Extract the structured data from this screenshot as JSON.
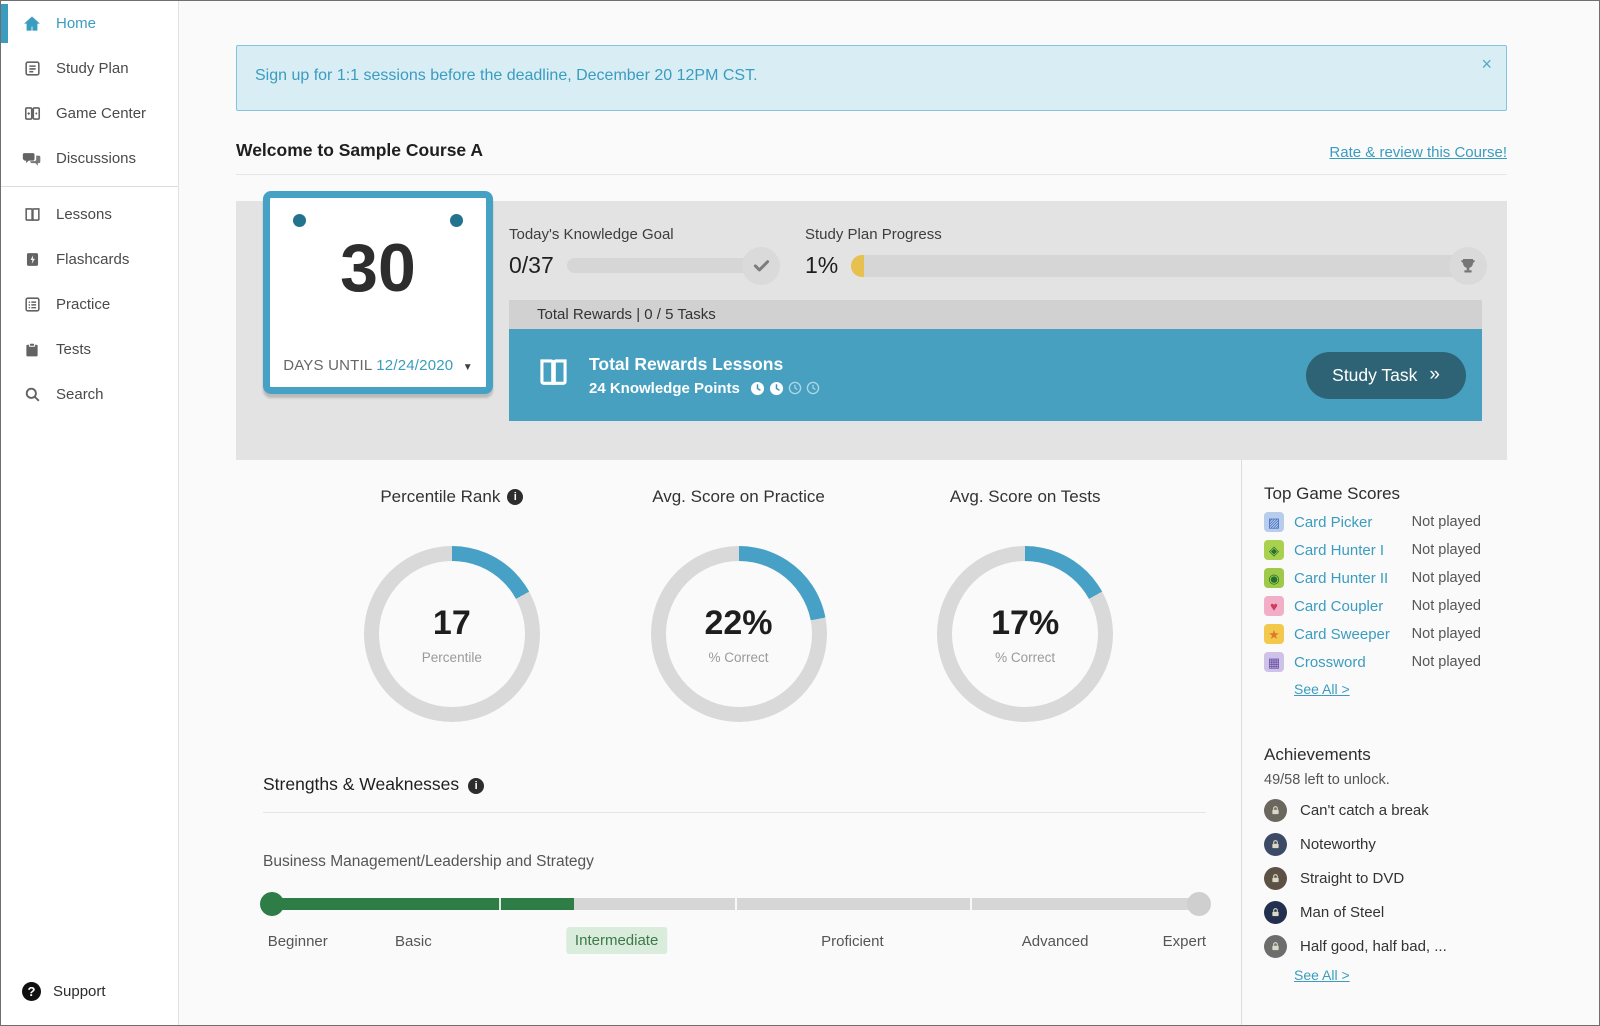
{
  "colors": {
    "accent_blue": "#3a9cbf",
    "card_blue": "#48a0c1",
    "button_teal": "#2d6374",
    "progress_gold": "#e6c14f",
    "skill_green": "#2e7d46"
  },
  "icons": {
    "close": "×",
    "caret_down": "▼",
    "chevron_right": "»"
  },
  "sidebar": {
    "items": [
      {
        "label": "Home",
        "active": true
      },
      {
        "label": "Study Plan"
      },
      {
        "label": "Game Center"
      },
      {
        "label": "Discussions"
      },
      {
        "label": "Lessons"
      },
      {
        "label": "Flashcards"
      },
      {
        "label": "Practice"
      },
      {
        "label": "Tests"
      },
      {
        "label": "Search"
      }
    ],
    "support_label": "Support"
  },
  "banner": {
    "message": "Sign up for 1:1 sessions before the deadline, December 20 12PM CST."
  },
  "header": {
    "title": "Welcome to Sample Course A",
    "rate_link": "Rate & review this Course!"
  },
  "hero": {
    "calendar": {
      "days": "30",
      "days_until_label": "DAYS UNTIL",
      "date": "12/24/2020"
    },
    "knowledge_goal": {
      "label": "Today's Knowledge Goal",
      "value": "0/37",
      "pct": 0
    },
    "study_plan_progress": {
      "label": "Study Plan Progress",
      "value": "1%",
      "pct": 1
    },
    "rewards_header": "Total Rewards | 0 / 5 Tasks",
    "task_card": {
      "title": "Total Rewards Lessons",
      "subtitle": "24 Knowledge Points",
      "button": "Study Task"
    }
  },
  "stats": {
    "donuts": [
      {
        "title": "Percentile Rank",
        "has_info": true,
        "value": "17",
        "caption": "Percentile",
        "pct": 17
      },
      {
        "title": "Avg. Score on Practice",
        "has_info": false,
        "value": "22%",
        "caption": "% Correct",
        "pct": 22
      },
      {
        "title": "Avg. Score on Tests",
        "has_info": false,
        "value": "17%",
        "caption": "% Correct",
        "pct": 17
      }
    ]
  },
  "strengths": {
    "title": "Strengths & Weaknesses",
    "subject": "Business Management/Leadership and Strategy",
    "progress_pct": 33,
    "levels": [
      "Beginner",
      "Basic",
      "Intermediate",
      "Proficient",
      "Advanced",
      "Expert"
    ],
    "active_index": 2
  },
  "games": {
    "title": "Top Game Scores",
    "see_all": "See All >",
    "items": [
      {
        "name": "Card Picker",
        "status": "Not played",
        "glyph": "▨",
        "bg": "#b8cdec",
        "fg": "#3f6fc0"
      },
      {
        "name": "Card Hunter I",
        "status": "Not played",
        "glyph": "◈",
        "bg": "#a9d14f",
        "fg": "#247031"
      },
      {
        "name": "Card Hunter II",
        "status": "Not played",
        "glyph": "◉",
        "bg": "#9fca49",
        "fg": "#247031"
      },
      {
        "name": "Card Coupler",
        "status": "Not played",
        "glyph": "♥",
        "bg": "#f3aec7",
        "fg": "#d23a5e"
      },
      {
        "name": "Card Sweeper",
        "status": "Not played",
        "glyph": "★",
        "bg": "#f2c94c",
        "fg": "#dd7a2a"
      },
      {
        "name": "Crossword",
        "status": "Not played",
        "glyph": "▦",
        "bg": "#cec2e8",
        "fg": "#6a4fa3"
      }
    ]
  },
  "achievements": {
    "title": "Achievements",
    "subtitle": "49/58 left to unlock.",
    "see_all": "See All >",
    "items": [
      {
        "name": "Can't catch a break",
        "badge_bg": "#6b675f"
      },
      {
        "name": "Noteworthy",
        "badge_bg": "#3d4a66"
      },
      {
        "name": "Straight to DVD",
        "badge_bg": "#5d5044"
      },
      {
        "name": "Man of Steel",
        "badge_bg": "#222f4d"
      },
      {
        "name": "Half good, half bad, ...",
        "badge_bg": "#6d6d6d"
      }
    ]
  }
}
